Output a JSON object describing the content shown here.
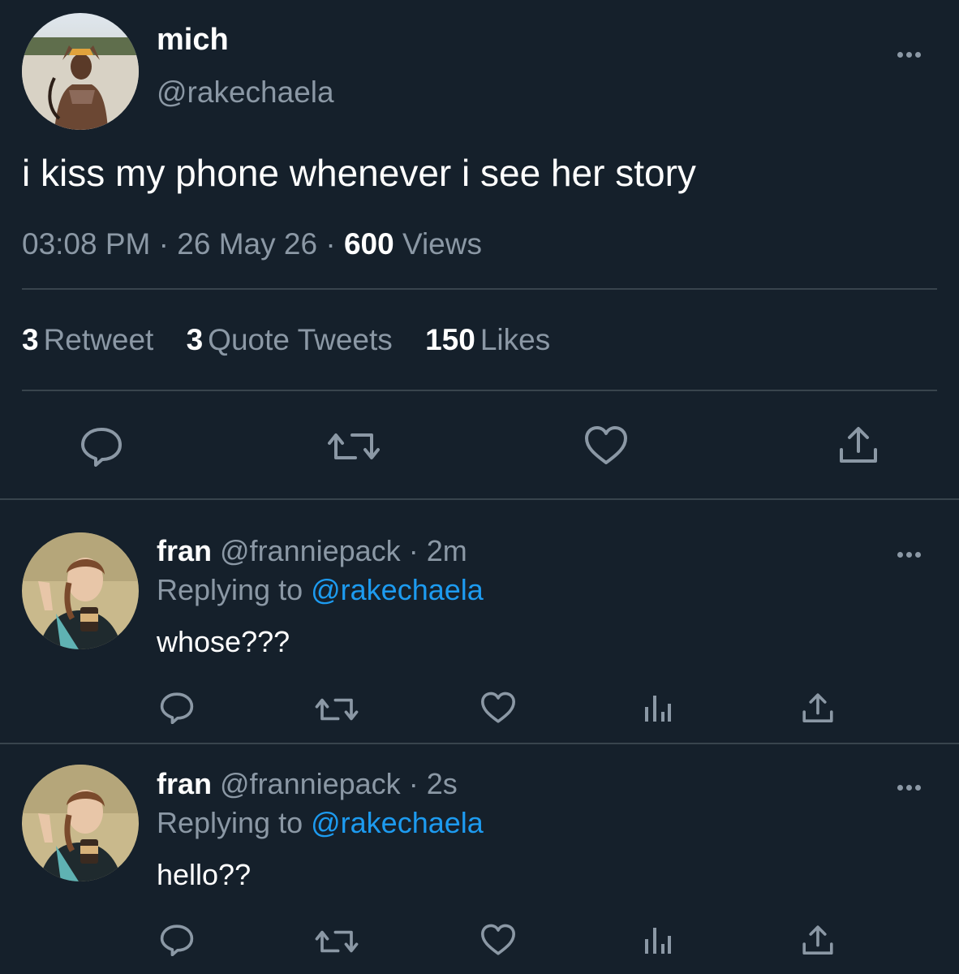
{
  "main_tweet": {
    "name": "mich",
    "handle": "@rakechaela",
    "text": "i kiss my phone whenever i see her story",
    "time": "03:08 PM",
    "date": "26 May 26",
    "separator": "·",
    "views_count": "600",
    "views_label": "Views",
    "stats": {
      "retweets_count": "3",
      "retweets_label": "Retweet",
      "quotes_count": "3",
      "quotes_label": "Quote Tweets",
      "likes_count": "150",
      "likes_label": "Likes"
    },
    "actions": [
      "reply-icon",
      "retweet-icon",
      "like-icon",
      "share-icon"
    ]
  },
  "replies": [
    {
      "name": "fran",
      "handle": "@franniepack",
      "time": "2m",
      "separator": "·",
      "replying_prefix": "Replying to",
      "replying_to": "@rakechaela",
      "text": "whose???"
    },
    {
      "name": "fran",
      "handle": "@franniepack",
      "time": "2s",
      "separator": "·",
      "replying_prefix": "Replying to",
      "replying_to": "@rakechaela",
      "text": "hello??"
    }
  ],
  "colors": {
    "background": "#15202b",
    "text_primary": "#ffffff",
    "text_secondary": "#8b98a5",
    "accent": "#1d9bf0",
    "divider": "#38444d"
  }
}
